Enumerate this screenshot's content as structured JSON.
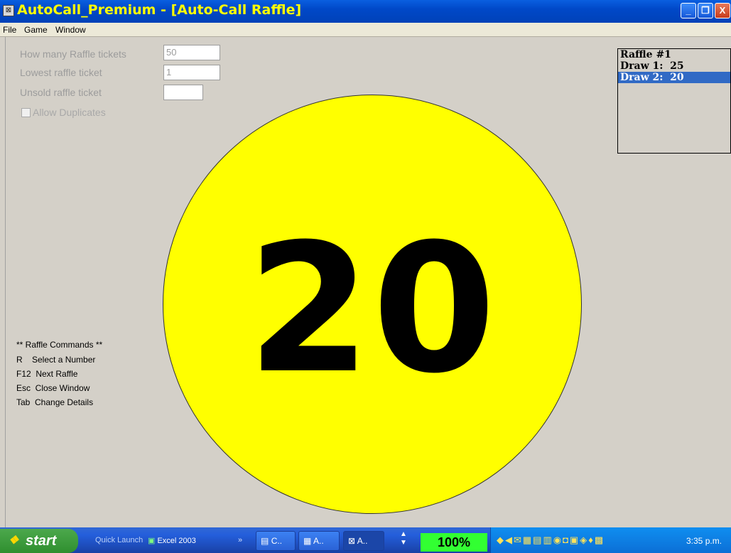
{
  "window": {
    "title": "AutoCall_Premium - [Auto-Call Raffle]",
    "controls": {
      "minimize": "_",
      "maximize": "❐",
      "close": "X"
    }
  },
  "menu": {
    "items": [
      "File",
      "Game",
      "Window"
    ]
  },
  "form": {
    "tickets_label": "How many Raffle tickets",
    "tickets_value": "50",
    "lowest_label": "Lowest raffle ticket",
    "lowest_value": "1",
    "unsold_label": "Unsold raffle ticket",
    "unsold_value": "",
    "allow_duplicates_label": "Allow Duplicates"
  },
  "ball": {
    "number": "20",
    "color": "#ffff00"
  },
  "commands": {
    "header": "** Raffle Commands **",
    "items": [
      "R    Select a Number",
      "F12  Next Raffle",
      "Esc  Close Window",
      "Tab  Change Details"
    ]
  },
  "draws": {
    "items": [
      "Raffle #1",
      "Draw 1:  25",
      "Draw 2:  20"
    ],
    "selected_index": 2
  },
  "taskbar": {
    "start_label": "start",
    "quick_launch_label": "Quick Launch",
    "excel_label": "Excel 2003",
    "task_buttons": [
      "C..",
      "A..",
      "A.."
    ],
    "zoom_level": "100%",
    "clock": "3:35 p.m."
  }
}
